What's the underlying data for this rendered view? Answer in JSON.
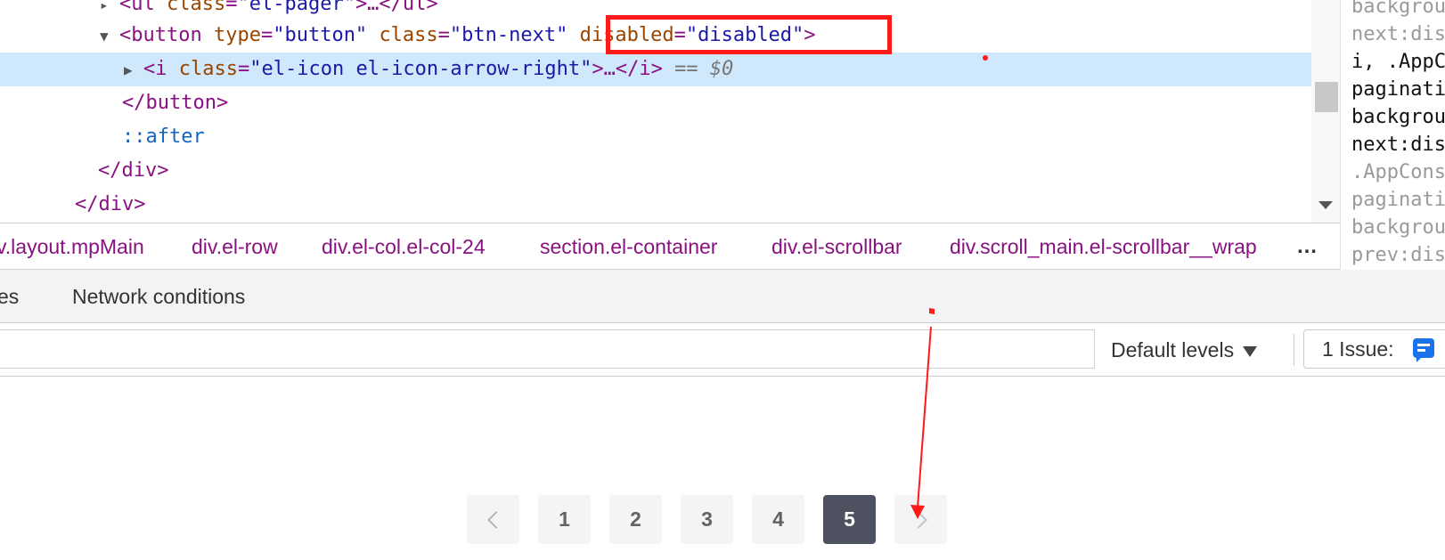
{
  "elements": {
    "line0": {
      "indent_char": "▸",
      "open": "<",
      "tag": "ul",
      "attr": "class",
      "eq": "=",
      "val": "\"el-pager\"",
      "rest": ">…</ul>"
    },
    "line1": {
      "open": "<",
      "tag": "button",
      "attr1": "type",
      "val1": "\"button\"",
      "attr2": "class",
      "val2": "\"btn-next\"",
      "attr3": "disabled",
      "val3": "\"disabled\"",
      "close": ">"
    },
    "line2": {
      "open": "<",
      "tag": "i",
      "attr": "class",
      "val": "\"el-icon el-icon-arrow-right\"",
      "rest": ">…</i>",
      "marker": "== $0"
    },
    "line3": {
      "text": "</button>"
    },
    "line4": {
      "text": "::after"
    },
    "line5": {
      "text": "</div>"
    },
    "line6": {
      "text": "</div>"
    }
  },
  "styles_pane": {
    "lines": [
      "backgrou",
      "next:dis",
      "i, .AppC",
      "paginati",
      "backgrou",
      "next:dis",
      ".AppCons",
      "paginati",
      "backgrou",
      "prev:dis"
    ]
  },
  "breadcrumbs": {
    "items": [
      "v.layout.mpMain",
      "div.el-row",
      "div.el-col.el-col-24",
      "section.el-container",
      "div.el-scrollbar",
      "div.scroll_main.el-scrollbar__wrap"
    ],
    "more": "…"
  },
  "drawer": {
    "tab_partial": "es",
    "tab_network": "Network conditions"
  },
  "console": {
    "filter_value": "",
    "levels_label": "Default levels",
    "issues_label": "1 Issue:",
    "issues_count": "1"
  },
  "pagination": {
    "pages": [
      "1",
      "2",
      "3",
      "4",
      "5"
    ],
    "current_page": "5",
    "prev_disabled": true,
    "next_disabled": true
  },
  "colors": {
    "highlight": "#ff1a1a",
    "selected_row": "#cfe8fc",
    "active_page": "#4e5260"
  }
}
